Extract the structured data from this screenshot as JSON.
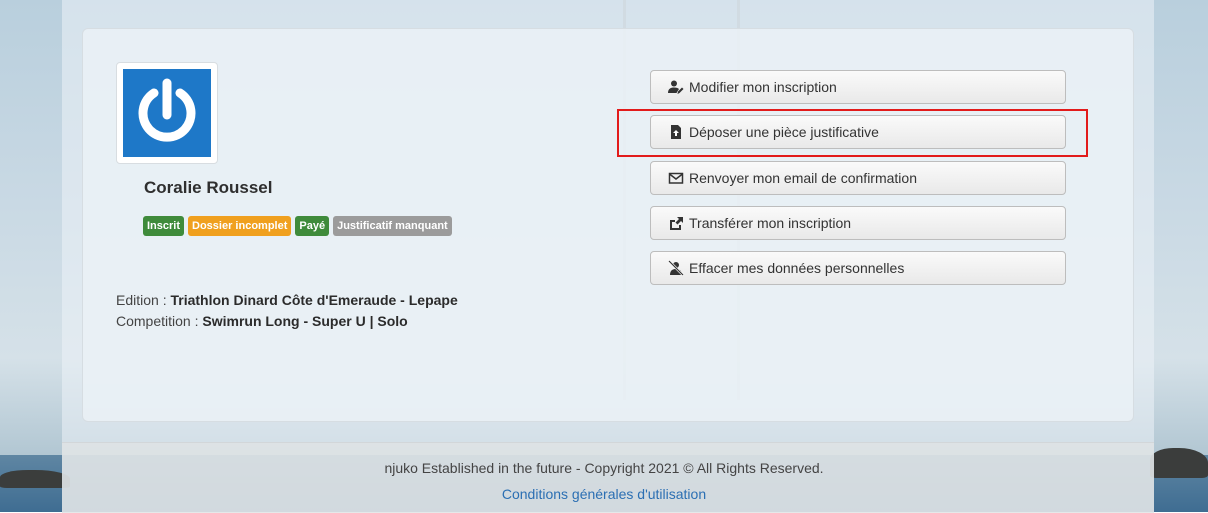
{
  "profile": {
    "name": "Coralie Roussel",
    "badges": [
      {
        "label": "Inscrit",
        "color": "#3f8b3b"
      },
      {
        "label": "Dossier incomplet",
        "color": "#f0a01e"
      },
      {
        "label": "Payé",
        "color": "#3f8b3b"
      },
      {
        "label": "Justificatif manquant",
        "color": "#9b9b9b"
      }
    ],
    "edition_label": "Edition : ",
    "edition_value": "Triathlon Dinard Côte d'Emeraude - Lepape",
    "competition_label": "Competition : ",
    "competition_value": "Swimrun Long - Super U | Solo"
  },
  "actions": [
    {
      "label": "Modifier mon inscription",
      "icon": "user-edit-icon"
    },
    {
      "label": "Déposer une pièce justificative",
      "icon": "file-upload-icon"
    },
    {
      "label": "Renvoyer mon email de confirmation",
      "icon": "envelope-icon"
    },
    {
      "label": "Transférer mon inscription",
      "icon": "share-icon"
    },
    {
      "label": "Effacer mes données personnelles",
      "icon": "user-slash-icon"
    }
  ],
  "footer": {
    "text": "njuko Established in the future - Copyright 2021 © All Rights Reserved.",
    "link": "Conditions générales d'utilisation"
  },
  "colors": {
    "highlight": "#e21b1b",
    "avatar_bg": "#1e78c8",
    "link": "#2b6fb3"
  }
}
